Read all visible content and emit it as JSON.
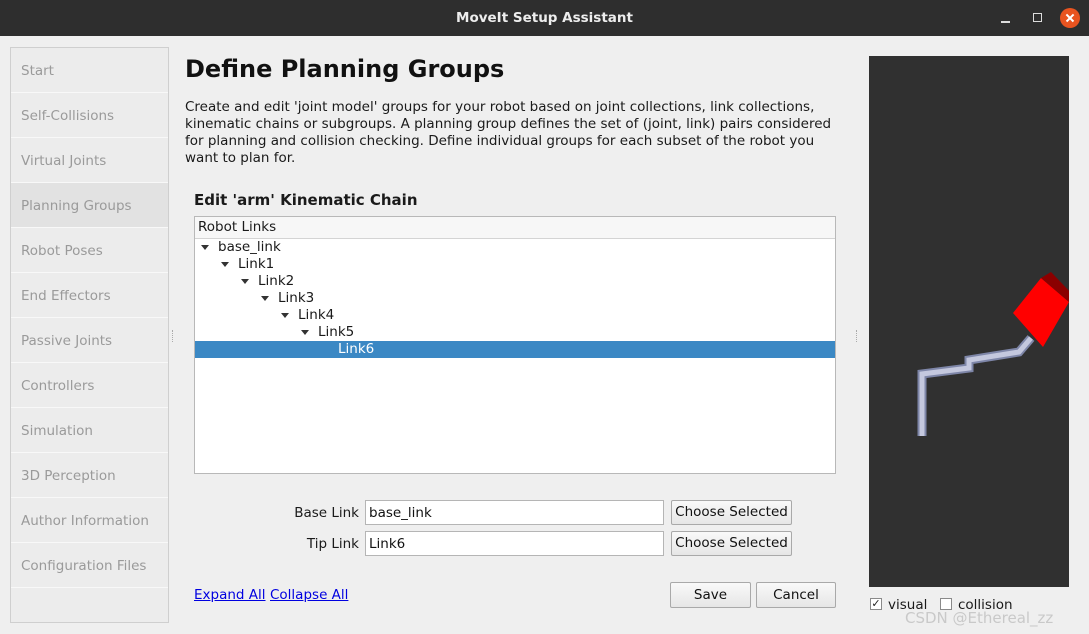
{
  "window": {
    "title": "MoveIt Setup Assistant"
  },
  "sidebar": {
    "items": [
      {
        "label": "Start"
      },
      {
        "label": "Self-Collisions"
      },
      {
        "label": "Virtual Joints"
      },
      {
        "label": "Planning Groups"
      },
      {
        "label": "Robot Poses"
      },
      {
        "label": "End Effectors"
      },
      {
        "label": "Passive Joints"
      },
      {
        "label": "Controllers"
      },
      {
        "label": "Simulation"
      },
      {
        "label": "3D Perception"
      },
      {
        "label": "Author Information"
      },
      {
        "label": "Configuration Files"
      }
    ],
    "active_index": 3
  },
  "main": {
    "title": "Define Planning Groups",
    "description": "Create and edit 'joint model' groups for your robot based on joint collections, link collections, kinematic chains or subgroups. A planning group defines the set of (joint, link) pairs considered for planning and collision checking. Define individual groups for each subset of the robot you want to plan for.",
    "section_title": "Edit 'arm' Kinematic Chain",
    "tree": {
      "header": "Robot Links",
      "rows": [
        {
          "label": "base_link",
          "expanded": true
        },
        {
          "label": "Link1",
          "expanded": true
        },
        {
          "label": "Link2",
          "expanded": true
        },
        {
          "label": "Link3",
          "expanded": true
        },
        {
          "label": "Link4",
          "expanded": true
        },
        {
          "label": "Link5",
          "expanded": true
        },
        {
          "label": "Link6",
          "selected": true
        }
      ]
    },
    "base_link": {
      "label": "Base Link",
      "value": "base_link",
      "button": "Choose Selected"
    },
    "tip_link": {
      "label": "Tip Link",
      "value": "Link6",
      "button": "Choose Selected"
    },
    "expand_all": "Expand All",
    "collapse_all": "Collapse All",
    "save": "Save",
    "cancel": "Cancel"
  },
  "viewport": {
    "visual_label": "visual",
    "visual_checked": true,
    "collision_label": "collision",
    "collision_checked": false
  },
  "watermark": "CSDN @Ethereal_zz",
  "colors": {
    "selection": "#3b88c4",
    "close_button": "#e95420",
    "end_effector": "#ff0000"
  }
}
